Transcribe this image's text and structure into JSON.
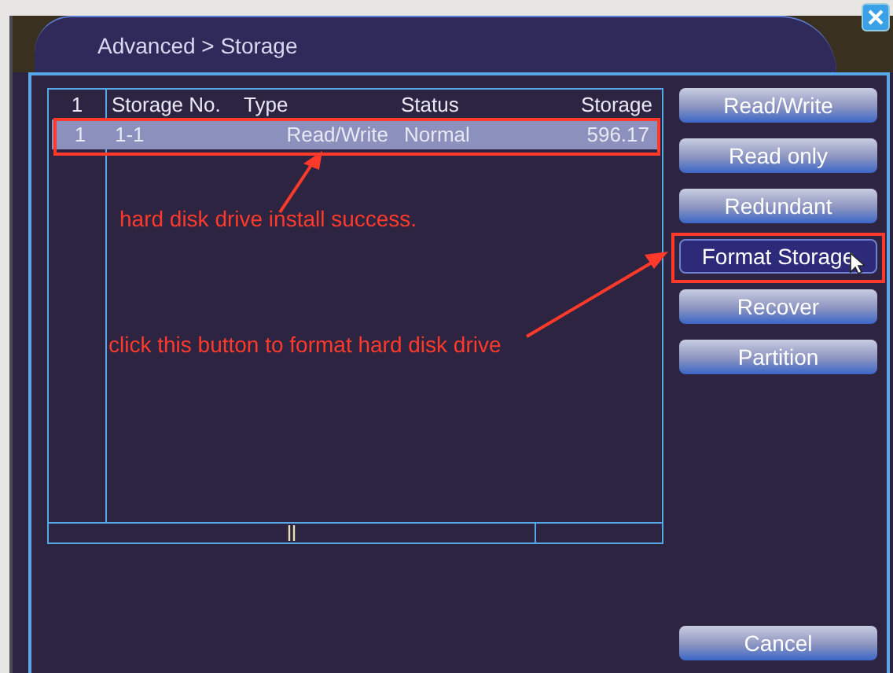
{
  "window": {
    "title": "Advanced > Storage"
  },
  "table": {
    "columns": [
      "1",
      "Storage No.",
      "Type",
      "Status",
      "Storage"
    ],
    "rows": [
      {
        "cells": [
          "1",
          "1-1",
          "Read/Write",
          "Normal",
          "596.17"
        ],
        "selected": true
      }
    ]
  },
  "buttons": [
    {
      "label": "Read/Write",
      "focused": false
    },
    {
      "label": "Read only",
      "focused": false
    },
    {
      "label": "Redundant",
      "focused": false
    },
    {
      "label": "Format Storage",
      "focused": true
    },
    {
      "label": "Recover",
      "focused": false
    },
    {
      "label": "Partition",
      "focused": false
    }
  ],
  "cancel_button": {
    "label": "Cancel"
  },
  "annotations": [
    {
      "text": "hard disk drive install success."
    },
    {
      "text": "click this button to format hard disk drive"
    }
  ]
}
